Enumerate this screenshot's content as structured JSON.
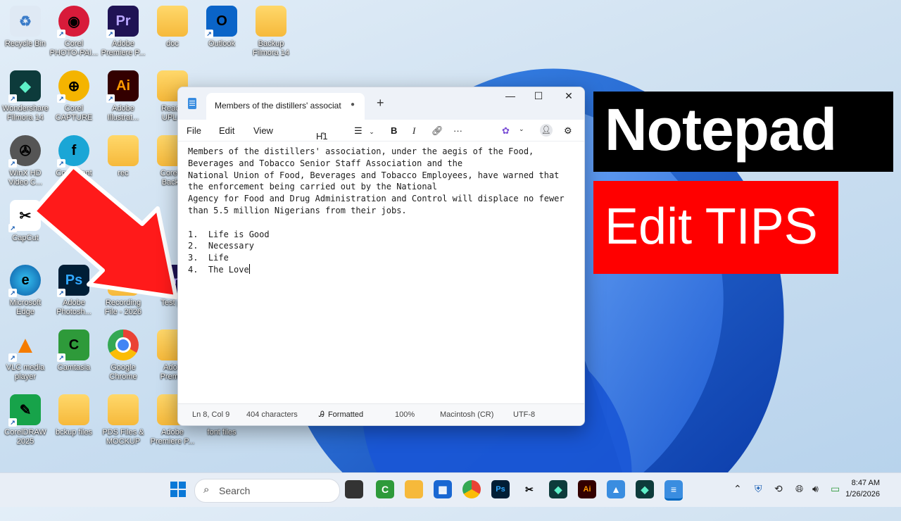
{
  "desktop": {
    "icons": [
      {
        "label": "Recycle Bin"
      },
      {
        "label": "Corel\nPHOTO-PAI..."
      },
      {
        "label": "Adobe\nPremiere P..."
      },
      {
        "label": "doc"
      },
      {
        "label": "Outlook"
      },
      {
        "label": "Backup\nFilmora 14"
      },
      {
        "label": "Wondershare\nFilmora 14"
      },
      {
        "label": "Corel\nCAPTURE"
      },
      {
        "label": "Adobe\nIllustrat..."
      },
      {
        "label": "Ready\nUPLO"
      },
      {
        "label": "WinX HD\nVideo C..."
      },
      {
        "label": "Corel Font"
      },
      {
        "label": "rec"
      },
      {
        "label": "CorelD\nBacku"
      },
      {
        "label": "CapCut"
      },
      {
        "label": "Microsoft\nEdge"
      },
      {
        "label": "Adobe\nPhotosh..."
      },
      {
        "label": "Recording\nFile - 2026"
      },
      {
        "label": "Test pr"
      },
      {
        "label": "VLC media\nplayer"
      },
      {
        "label": "Camtasia"
      },
      {
        "label": "Google\nChrome"
      },
      {
        "label": "Adob\nPremie"
      },
      {
        "label": "CorelDRAW\n2025"
      },
      {
        "label": "bckup files"
      },
      {
        "label": "PDS Files &\nMOCKUP"
      },
      {
        "label": "Adobe\nPremiere P..."
      },
      {
        "label": "font files"
      }
    ]
  },
  "notepad": {
    "tab_title": "Members of the distillers' associat",
    "tab_dot": "●",
    "new_tab": "+",
    "controls": {
      "minimize": "—",
      "maximize": "☐",
      "close": "✕"
    },
    "menu": {
      "file": "File",
      "edit": "Edit",
      "view": "View"
    },
    "toolbar": {
      "heading": "H1",
      "bold": "B",
      "italic": "I",
      "more": "···"
    },
    "content": "Members of the distillers' association, under the aegis of the Food,\nBeverages and Tobacco Senior Staff Association and the\nNational Union of Food, Beverages and Tobacco Employees, have warned that\nthe enforcement being carried out by the National\nAgency for Food and Drug Administration and Control will displace no fewer\nthan 5.5 million Nigerians from their jobs.\n\n1.  Life is Good\n2.  Necessary\n3.  Life\n4.  The Love",
    "status": {
      "position": "Ln 8, Col 9",
      "characters": "404 characters",
      "format": "Formatted",
      "zoom": "100%",
      "line_ending": "Macintosh (CR)",
      "encoding": "UTF-8"
    }
  },
  "banners": {
    "title": "Notepad",
    "subtitle": "Edit TIPS"
  },
  "taskbar": {
    "search_placeholder": "Search",
    "time": "8:47 AM",
    "date": "1/26/2026"
  },
  "colors": {
    "accent": "#0067c0",
    "banner_red": "#ff0000",
    "banner_black": "#000000"
  }
}
